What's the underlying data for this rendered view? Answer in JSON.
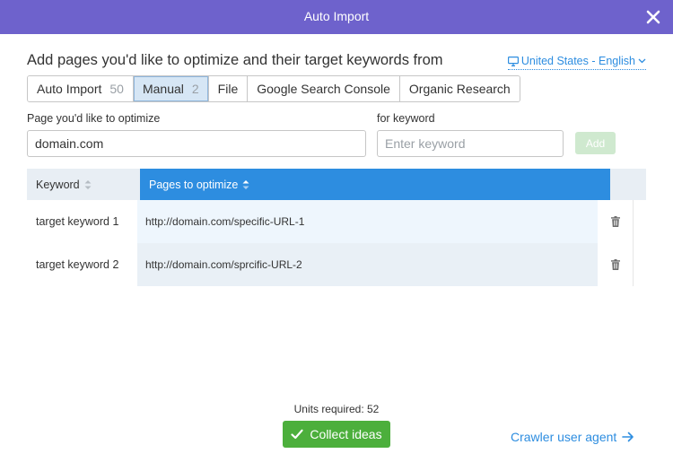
{
  "dialog": {
    "title": "Auto Import",
    "heading": "Add pages you'd like to optimize and their target keywords from",
    "locale": "United States - English"
  },
  "tabs": [
    {
      "label": "Auto Import",
      "count": "50",
      "active": false
    },
    {
      "label": "Manual",
      "count": "2",
      "active": true
    },
    {
      "label": "File",
      "count": "",
      "active": false
    },
    {
      "label": "Google Search Console",
      "count": "",
      "active": false
    },
    {
      "label": "Organic Research",
      "count": "",
      "active": false
    }
  ],
  "form": {
    "page_label": "Page you'd like to optimize",
    "page_value": "domain.com",
    "keyword_label": "for keyword",
    "keyword_placeholder": "Enter keyword",
    "add_label": "Add"
  },
  "table": {
    "col_keyword": "Keyword",
    "col_pages": "Pages to optimize",
    "rows": [
      {
        "keyword": "target keyword 1",
        "url": "http://domain.com/specific-URL-1"
      },
      {
        "keyword": "target keyword 2",
        "url": "http://domain.com/sprcific-URL-2"
      }
    ]
  },
  "footer": {
    "units": "Units required: 52",
    "collect_label": "Collect ideas",
    "crawler_label": "Crawler user agent"
  },
  "colors": {
    "header": "#6e62cc",
    "accent": "#2d8de0",
    "primary_button": "#4caf3c",
    "disabled_button": "#cfe9cf"
  }
}
